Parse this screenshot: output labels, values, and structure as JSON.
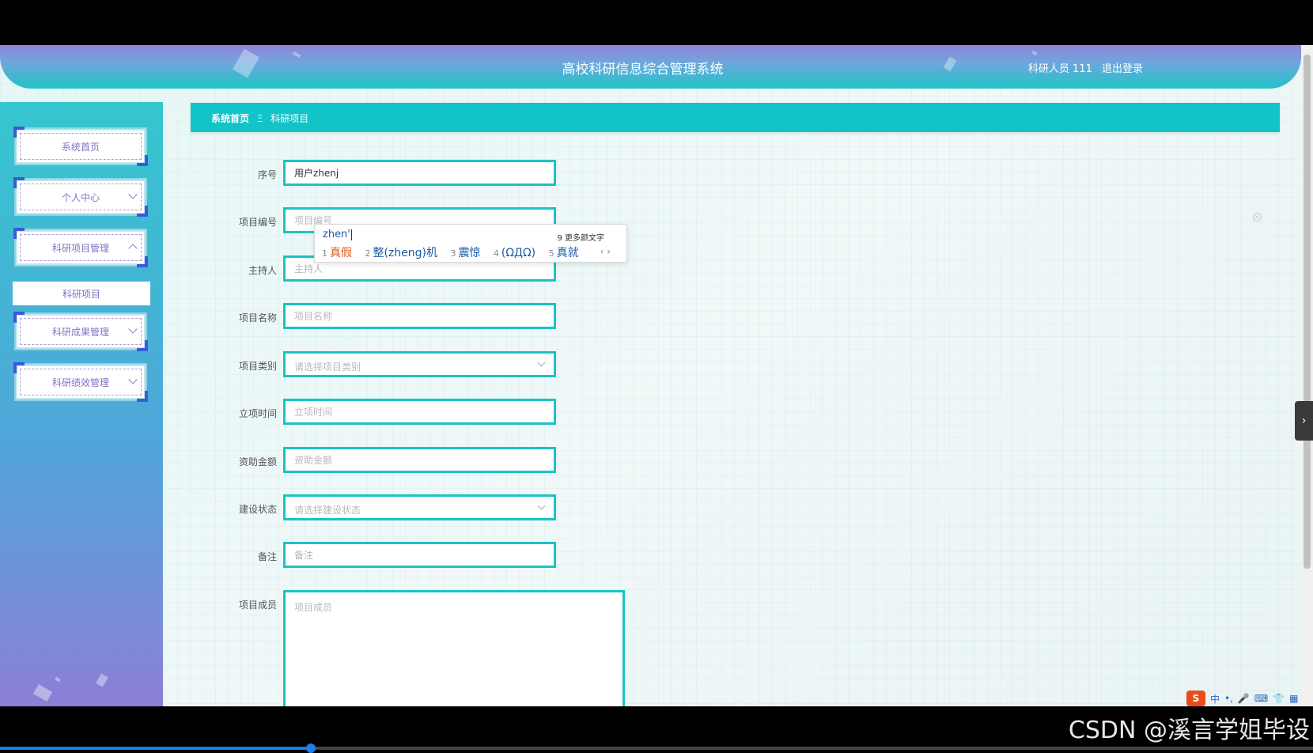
{
  "header": {
    "title": "高校科研信息综合管理系统",
    "user_label": "科研人员 111",
    "logout_label": "退出登录"
  },
  "sidebar": {
    "items": [
      {
        "label": "系统首页"
      },
      {
        "label": "个人中心"
      },
      {
        "label": "科研项目管理"
      },
      {
        "label": "科研成果管理"
      },
      {
        "label": "科研绩效管理"
      }
    ],
    "submenu": {
      "label": "科研项目"
    }
  },
  "breadcrumb": {
    "home": "系统首页",
    "separator": "Ξ",
    "current": "科研项目"
  },
  "form": {
    "fields": [
      {
        "label": "序号",
        "value": "用户zhenj",
        "placeholder": ""
      },
      {
        "label": "项目编号",
        "value": "",
        "placeholder": "项目编号"
      },
      {
        "label": "主持人",
        "value": "",
        "placeholder": "主持人"
      },
      {
        "label": "项目名称",
        "value": "",
        "placeholder": "项目名称"
      },
      {
        "label": "项目类别",
        "value": "",
        "placeholder": "请选择项目类别"
      },
      {
        "label": "立项时间",
        "value": "",
        "placeholder": "立项时间"
      },
      {
        "label": "资助金额",
        "value": "",
        "placeholder": "资助金额"
      },
      {
        "label": "建设状态",
        "value": "",
        "placeholder": "请选择建设状态"
      },
      {
        "label": "备注",
        "value": "",
        "placeholder": "备注"
      },
      {
        "label": "项目成员",
        "value": "",
        "placeholder": "项目成员"
      }
    ]
  },
  "ime": {
    "pinyin": "zhen'",
    "more_label": "9 更多颜文字",
    "candidates": [
      {
        "num": "1",
        "text": "真假"
      },
      {
        "num": "2",
        "text": "整(zheng)机"
      },
      {
        "num": "3",
        "text": "震惊"
      },
      {
        "num": "4",
        "text": "(ΩДΩ)"
      },
      {
        "num": "5",
        "text": "真就"
      }
    ],
    "arrows": "‹ ›"
  },
  "ime_toolbar": {
    "logo": "S",
    "mode": "中",
    "icons": [
      "•,",
      "🎤",
      "⌨",
      "👕",
      "▦"
    ]
  },
  "watermark": "CSDN @溪言学姐毕设",
  "video_progress_fraction": 0.237,
  "colors": {
    "accent": "#12c3c8",
    "field_border": "#1ac3c5",
    "menu_text": "#8670c8",
    "ime_selected": "#e2571e"
  }
}
